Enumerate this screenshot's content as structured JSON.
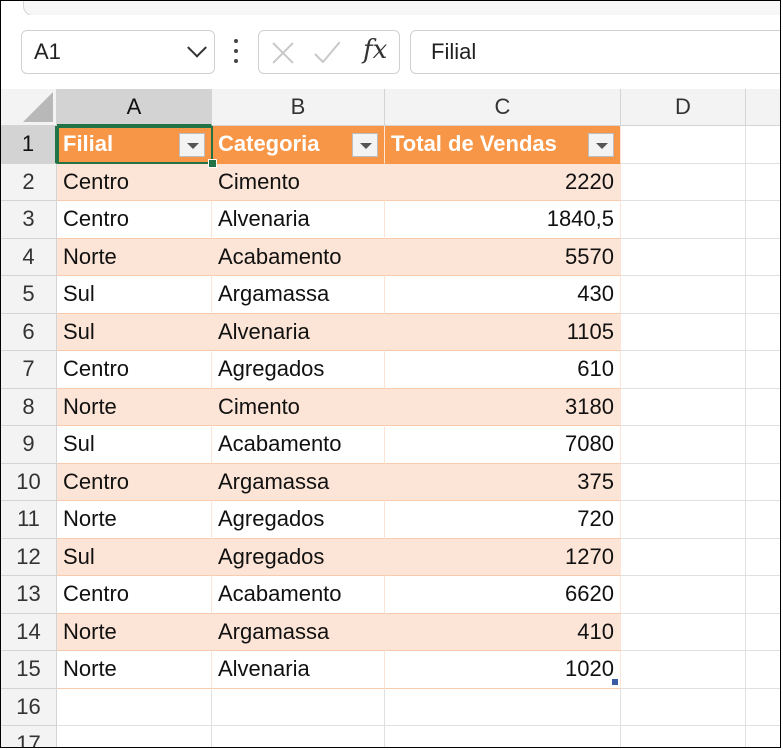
{
  "formula_bar": {
    "name_box": "A1",
    "formula_value": "Filial",
    "fx_label": "fx"
  },
  "columns": [
    "A",
    "B",
    "C",
    "D"
  ],
  "rows": [
    "1",
    "2",
    "3",
    "4",
    "5",
    "6",
    "7",
    "8",
    "9",
    "10",
    "11",
    "12",
    "13",
    "14",
    "15",
    "16",
    "17"
  ],
  "table": {
    "headers": [
      "Filial",
      "Categoria",
      "Total de Vendas"
    ],
    "data": [
      [
        "Centro",
        "Cimento",
        "2220"
      ],
      [
        "Centro",
        "Alvenaria",
        "1840,5"
      ],
      [
        "Norte",
        "Acabamento",
        "5570"
      ],
      [
        "Sul",
        "Argamassa",
        "430"
      ],
      [
        "Sul",
        "Alvenaria",
        "1105"
      ],
      [
        "Centro",
        "Agregados",
        "610"
      ],
      [
        "Norte",
        "Cimento",
        "3180"
      ],
      [
        "Sul",
        "Acabamento",
        "7080"
      ],
      [
        "Centro",
        "Argamassa",
        "375"
      ],
      [
        "Norte",
        "Agregados",
        "720"
      ],
      [
        "Sul",
        "Agregados",
        "1270"
      ],
      [
        "Centro",
        "Acabamento",
        "6620"
      ],
      [
        "Norte",
        "Argamassa",
        "410"
      ],
      [
        "Norte",
        "Alvenaria",
        "1020"
      ]
    ]
  },
  "colors": {
    "header_fill": "#f79646",
    "band_fill": "#fce4d6",
    "selection": "#217346"
  },
  "icons": [
    "chevron-down-icon",
    "more-options-icon",
    "cancel-icon",
    "enter-icon",
    "insert-function-icon",
    "filter-dropdown-icon"
  ]
}
